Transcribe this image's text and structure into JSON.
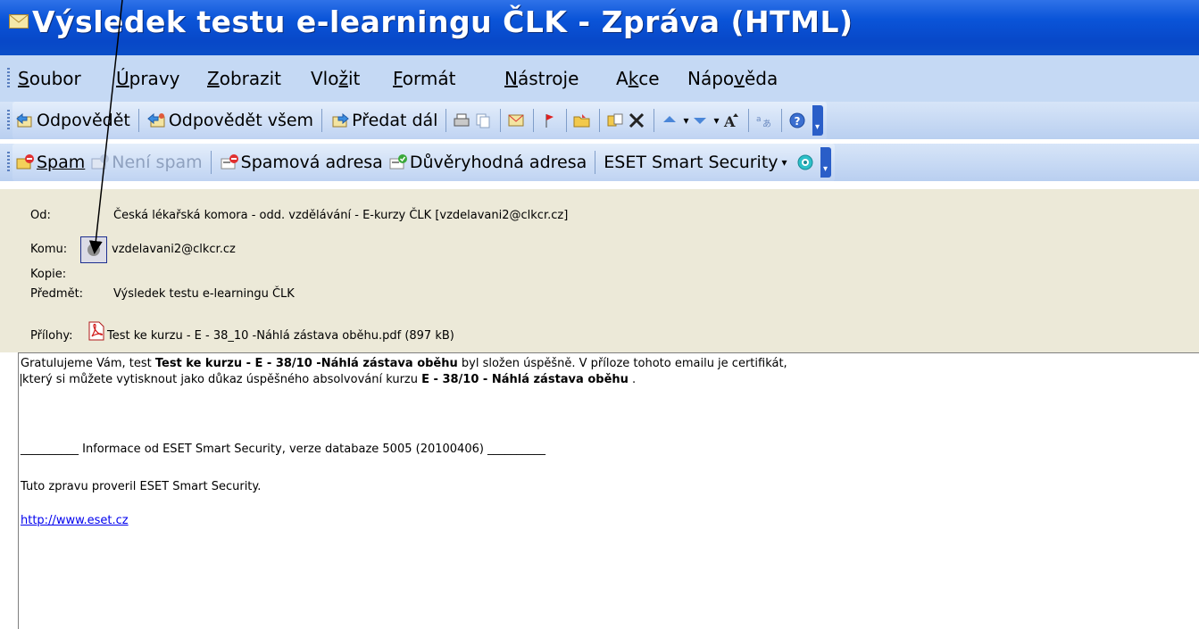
{
  "window": {
    "title": "Výsledek testu e-learningu ČLK - Zpráva (HTML)"
  },
  "menu": {
    "items": [
      "Soubor",
      "Úpravy",
      "Zobrazit",
      "Vložit",
      "Formát",
      "Nástroje",
      "Akce",
      "Nápověda"
    ]
  },
  "toolbar1": {
    "reply": "Odpovědět",
    "reply_all": "Odpovědět všem",
    "forward": "Předat dál",
    "icons": [
      "print-icon",
      "copy-icon",
      "envelope-flag-icon",
      "follow-up-flag-icon",
      "open-folder-icon",
      "move-icon",
      "delete-icon",
      "previous-item-icon",
      "next-item-icon",
      "font-size-icon",
      "encoding-icon",
      "help-icon"
    ]
  },
  "toolbar2": {
    "spam": "Spam",
    "not_spam": "Není spam",
    "spam_address": "Spamová adresa",
    "trusted_address": "Důvěryhodná adresa",
    "eset": "ESET Smart Security"
  },
  "header": {
    "from_label": "Od:",
    "from_value": "Česká lékařská komora - odd. vzdělávání  - E-kurzy ČLK [vzdelavani2@clkcr.cz]",
    "to_label": "Komu:",
    "to_value": "vzdelavani2@clkcr.cz",
    "cc_label": "Kopie:",
    "subject_label": "Předmět:",
    "subject_value": "Výsledek testu e-learningu ČLK",
    "attachments_label": "Přílohy:",
    "attachment_name": "Test ke kurzu - E - 38_10 -Náhlá zástava oběhu.pdf (897 kB)"
  },
  "body": {
    "line1_prefix": "Gratulujeme Vám, test ",
    "line1_bold": "Test ke kurzu - E - 38/10 -Náhlá zástava oběhu",
    "line1_suffix": " byl složen úspěšně. V příloze tohoto emailu je certifikát,",
    "line2_prefix": "který si můžete vytisknout jako důkaz úspěšného absolvování kurzu ",
    "line2_bold": "E - 38/10 - Náhlá zástava oběhu",
    "line2_suffix": " .",
    "eset_info": "__________ Informace od ESET Smart Security, verze databaze 5005 (20100406) __________",
    "eset_checked": "Tuto zpravu proveril ESET Smart Security.",
    "eset_link": "http://www.eset.cz"
  },
  "colors": {
    "titlebar": "#0a54d8",
    "menubar": "#c5d9f4",
    "header_bg": "#ece9d8",
    "link": "#0000ee"
  }
}
